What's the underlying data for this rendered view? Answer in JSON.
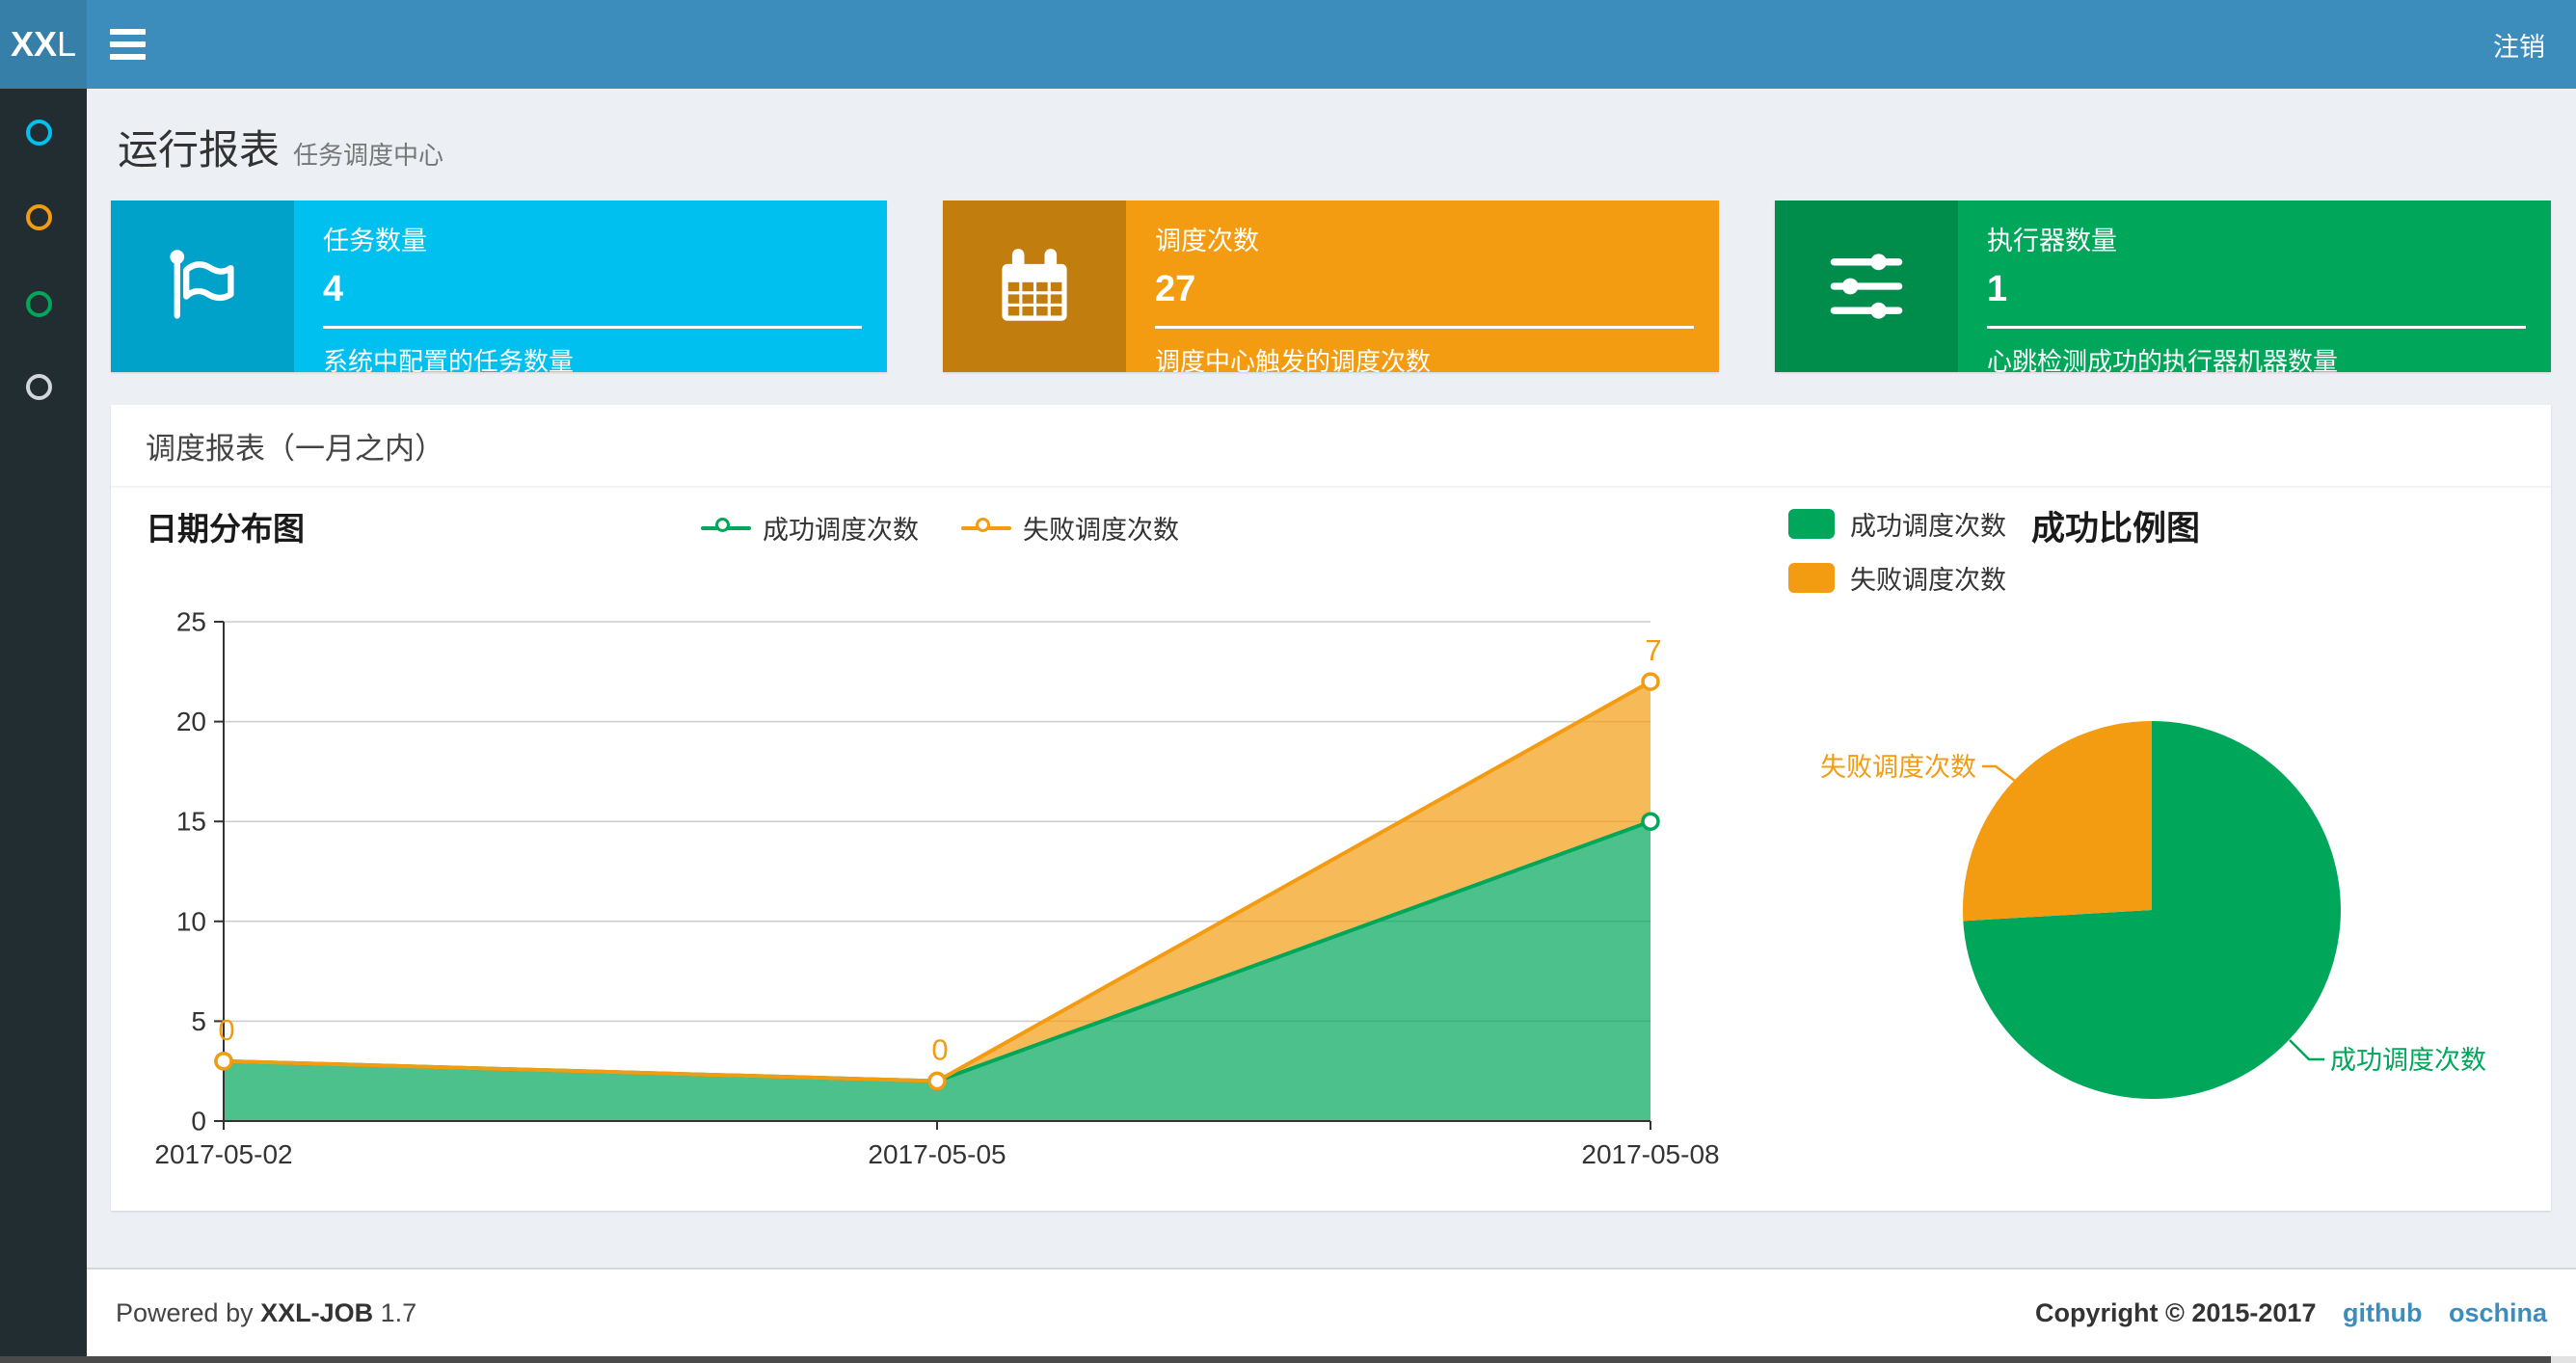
{
  "navbar": {
    "logo_bold": "XX",
    "logo_light": "L",
    "logout_label": "注销"
  },
  "sidebar": {
    "items": [
      {
        "icon": "circle-outline-icon",
        "color": "#00c0ef"
      },
      {
        "icon": "circle-outline-icon",
        "color": "#f39c12"
      },
      {
        "icon": "circle-outline-icon",
        "color": "#00a65a"
      },
      {
        "icon": "circle-outline-icon",
        "color": "#d2d6de"
      }
    ]
  },
  "page": {
    "title": "运行报表",
    "subtitle": "任务调度中心"
  },
  "info_boxes": [
    {
      "title": "任务数量",
      "value": "4",
      "desc": "系统中配置的任务数量",
      "icon": "flag-icon",
      "color": "#00c0ef",
      "icon_bg": "#00a2ca"
    },
    {
      "title": "调度次数",
      "value": "27",
      "desc": "调度中心触发的调度次数",
      "icon": "calendar-icon",
      "color": "#f39c12",
      "icon_bg": "#c17d0e"
    },
    {
      "title": "执行器数量",
      "value": "1",
      "desc": "心跳检测成功的执行器机器数量",
      "icon": "sliders-icon",
      "color": "#00a65a",
      "icon_bg": "#008d4c"
    }
  ],
  "panel": {
    "title": "调度报表（一月之内）"
  },
  "footer": {
    "powered_prefix": "Powered by",
    "product": "XXL-JOB",
    "version": "1.7",
    "copyright": "Copyright © 2015-2017",
    "links": [
      "github",
      "oschina"
    ]
  },
  "colors": {
    "navbar": "#3c8dbc",
    "logo_bg": "#367fa9",
    "sidebar_bg": "#222d32",
    "content_bg": "#ecf0f5",
    "success": "#00a65a",
    "warning": "#f39c12",
    "info": "#00c0ef"
  },
  "chart_data": [
    {
      "type": "area",
      "title": "日期分布图",
      "x": [
        "2017-05-02",
        "2017-05-05",
        "2017-05-08"
      ],
      "stacked": true,
      "series": [
        {
          "key": "success",
          "name": "成功调度次数",
          "values": [
            3,
            2,
            15
          ],
          "color": "#00a65a"
        },
        {
          "key": "fail",
          "name": "失败调度次数",
          "values": [
            0,
            0,
            7
          ],
          "color": "#f39c12",
          "point_labels": [
            "0",
            "0",
            "7"
          ]
        }
      ],
      "ylim": [
        0,
        25
      ],
      "yticks": [
        0,
        5,
        10,
        15,
        20,
        25
      ],
      "grid": true,
      "legend_position": "top-center"
    },
    {
      "type": "pie",
      "title": "成功比例图",
      "slices": [
        {
          "key": "success",
          "label": "成功调度次数",
          "value": 20,
          "color": "#00a65a"
        },
        {
          "key": "fail",
          "label": "失败调度次数",
          "value": 7,
          "color": "#f39c12"
        }
      ],
      "legend_position": "top-left"
    }
  ]
}
